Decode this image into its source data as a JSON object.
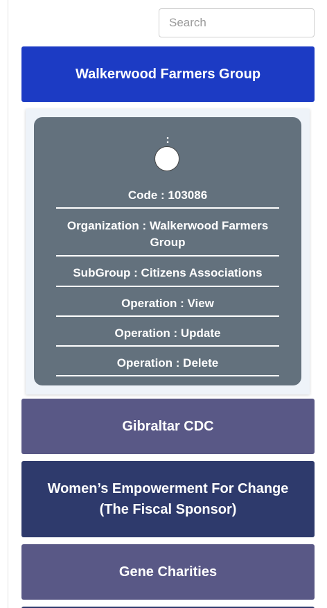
{
  "search": {
    "placeholder": "Search"
  },
  "cards": [
    {
      "label": "Walkerwood Farmers Group",
      "color": "#1c3bc4"
    },
    {
      "label": "Gibraltar CDC",
      "color": "#595886"
    },
    {
      "label": "Women’s Empowerment For Change (The Fiscal Sponsor)",
      "color": "#2e3a6c"
    },
    {
      "label": "Gene Charities",
      "color": "#595886"
    }
  ],
  "detail": {
    "colon": ":",
    "avatar_icon": "profile-placeholder-icon",
    "code": "Code : 103086",
    "organization": "Organization : Walkerwood Farmers Group",
    "subgroup": "SubGroup : Citizens Associations",
    "operations": [
      "Operation : View",
      "Operation : Update",
      "Operation : Delete"
    ],
    "panel_color": "#63717d"
  }
}
